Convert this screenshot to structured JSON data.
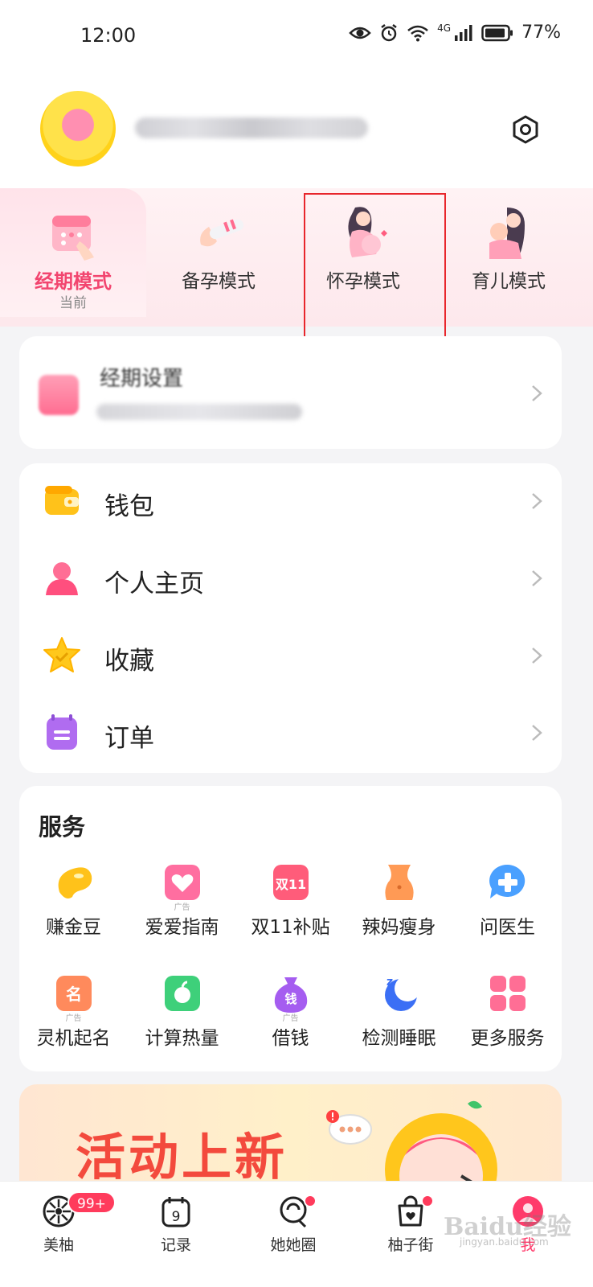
{
  "status_bar": {
    "time": "12:00",
    "network": "4G",
    "battery": "77%"
  },
  "modes": [
    {
      "label": "经期模式",
      "sub": "当前",
      "active": true
    },
    {
      "label": "备孕模式"
    },
    {
      "label": "怀孕模式"
    },
    {
      "label": "育儿模式"
    }
  ],
  "period_card": {
    "title": "经期设置"
  },
  "menu": [
    {
      "label": "钱包",
      "icon": "wallet-icon"
    },
    {
      "label": "个人主页",
      "icon": "person-icon"
    },
    {
      "label": "收藏",
      "icon": "star-icon"
    },
    {
      "label": "订单",
      "icon": "order-icon"
    }
  ],
  "services": {
    "title": "服务",
    "ad_label": "广告",
    "items": [
      {
        "label": "赚金豆",
        "icon": "bean-icon"
      },
      {
        "label": "爱爱指南",
        "icon": "heart-book-icon",
        "ad": true
      },
      {
        "label": "双11补贴",
        "icon": "double11-icon",
        "glyph": "双11"
      },
      {
        "label": "辣妈瘦身",
        "icon": "waist-icon"
      },
      {
        "label": "问医生",
        "icon": "doctor-chat-icon"
      },
      {
        "label": "灵机起名",
        "icon": "name-icon",
        "ad": true,
        "glyph": "名"
      },
      {
        "label": "计算热量",
        "icon": "apple-icon"
      },
      {
        "label": "借钱",
        "icon": "money-bag-icon",
        "ad": true,
        "glyph": "钱"
      },
      {
        "label": "检测睡眠",
        "icon": "sleep-moon-icon"
      },
      {
        "label": "更多服务",
        "icon": "grid-icon"
      }
    ]
  },
  "banner": {
    "text": "活动上新"
  },
  "tabbar": [
    {
      "label": "美柚",
      "badge": "99+"
    },
    {
      "label": "记录",
      "glyph": "9"
    },
    {
      "label": "她她圈"
    },
    {
      "label": "柚子街"
    },
    {
      "label": "我"
    }
  ],
  "watermark": {
    "text": "Baidu经验",
    "url": "jingyan.baidu.com"
  },
  "colors": {
    "accent": "#f2456f",
    "highlight_box": "#e8262c",
    "badge": "#ff3b5c"
  }
}
